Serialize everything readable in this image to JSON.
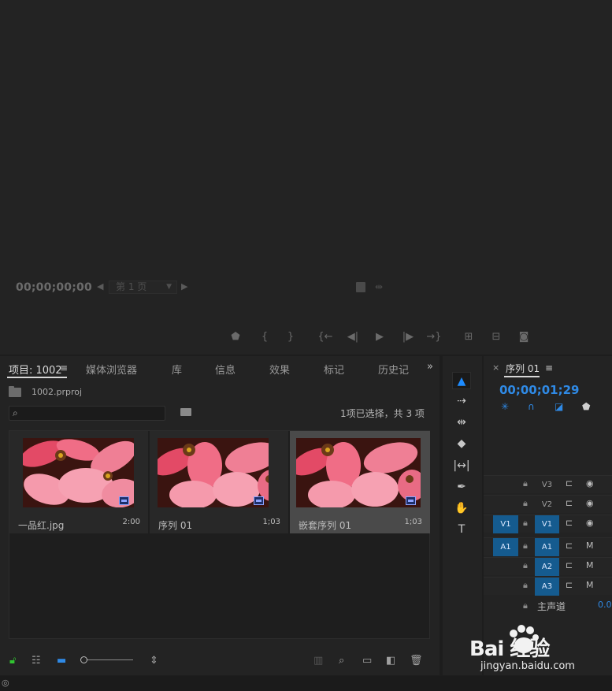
{
  "monitor": {
    "timecode": "00;00;00;00",
    "page_select": "第 1 页"
  },
  "project_panel": {
    "tabs": [
      {
        "label": "项目: 1002",
        "active": true
      },
      {
        "label": "媒体浏览器"
      },
      {
        "label": "库"
      },
      {
        "label": "信息"
      },
      {
        "label": "效果"
      },
      {
        "label": "标记"
      },
      {
        "label": "历史记"
      }
    ],
    "project_file": "1002.prproj",
    "search": {
      "value": "",
      "placeholder": ""
    },
    "selection_status": "1项已选择，共 3 项",
    "items": [
      {
        "name": "一品红.jpg",
        "duration": "2:00",
        "selected": false
      },
      {
        "name": "序列 01",
        "duration": "1;03",
        "selected": false
      },
      {
        "name": "嵌套序列 01",
        "duration": "1;03",
        "selected": true
      }
    ]
  },
  "tools_panel": {
    "tools": [
      "selection-tool",
      "track-select-tool",
      "ripple-edit-tool",
      "razor-tool",
      "slip-tool",
      "pen-tool",
      "hand-tool",
      "type-tool"
    ]
  },
  "timeline": {
    "title": "序列 01",
    "timecode": "00;00;01;29",
    "tracks": [
      {
        "label": "V3",
        "type": "video",
        "targeted": false
      },
      {
        "label": "V2",
        "type": "video",
        "targeted": false
      },
      {
        "label": "V1",
        "type": "video",
        "targeted": true,
        "source": "V1"
      },
      {
        "label": "A1",
        "type": "audio",
        "targeted": true,
        "source": "A1",
        "mute": "M"
      },
      {
        "label": "A2",
        "type": "audio",
        "targeted": true,
        "mute": "M"
      },
      {
        "label": "A3",
        "type": "audio",
        "targeted": true,
        "mute": "M"
      }
    ],
    "master_label": "主声道",
    "master_value": "0.0"
  },
  "watermark": {
    "brand": "Bai  经验",
    "url": "jingyan.baidu.com"
  },
  "colors": {
    "accent_blue": "#2f8ae6",
    "track_target": "#155b8f",
    "panel_bg": "#232323"
  }
}
